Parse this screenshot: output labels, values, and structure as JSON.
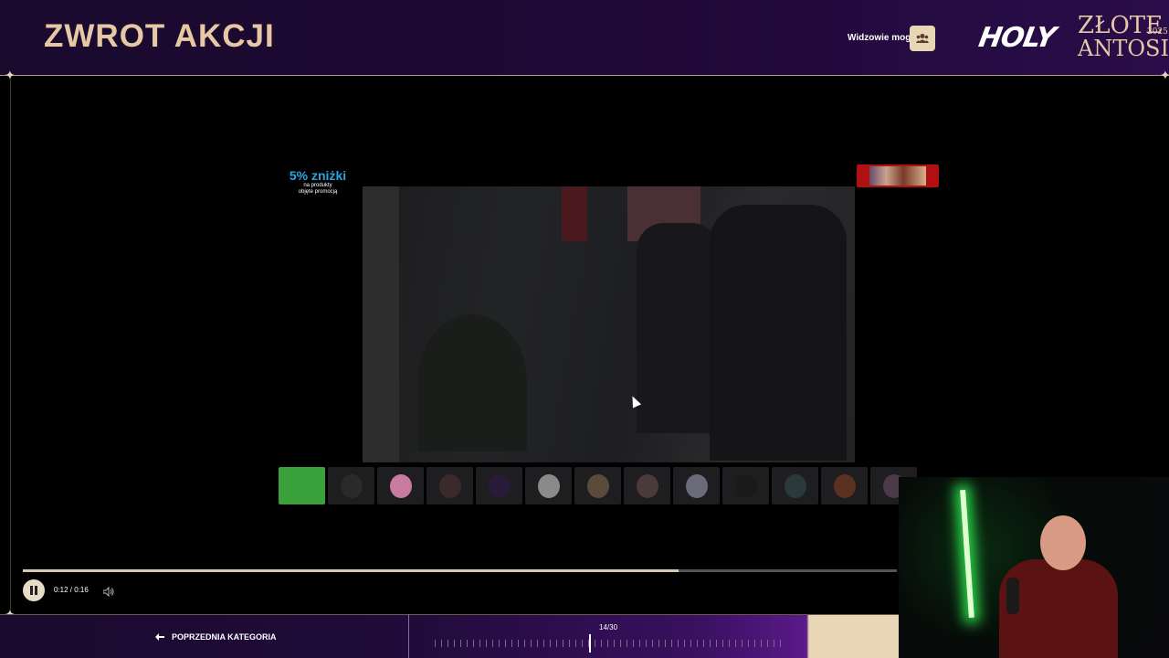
{
  "header": {
    "title": "ZWROT AKCJI",
    "viewers_label": "Widzowie mogą",
    "viewers_icon": "users-icon",
    "logo_holy": "HOLY",
    "logo_zlote_line1": "ZŁOTE",
    "logo_zlote_line2": "ANTOSIE",
    "logo_year": "2025"
  },
  "promo": {
    "title": "5% zniżki",
    "subtitle_line1": "na produkty",
    "subtitle_line2": "objęte promocją"
  },
  "player": {
    "time": "0:12 / 0:16",
    "progress": 0.75,
    "state": "playing"
  },
  "navigation": {
    "previous_label": "POPRZEDNIA KATEGORIA",
    "counter": "14/30",
    "current": 14,
    "total": 30
  },
  "thumbnails": [
    {
      "name": "nominee-1",
      "color": "#3aa03a"
    },
    {
      "name": "nominee-2",
      "color": "#2a2a2a"
    },
    {
      "name": "nominee-3",
      "color": "#c87aa0"
    },
    {
      "name": "nominee-4",
      "color": "#3a2a2a"
    },
    {
      "name": "nominee-5",
      "color": "#2a1a3a"
    },
    {
      "name": "nominee-6",
      "color": "#8a8a8a"
    },
    {
      "name": "nominee-7",
      "color": "#5a4a3a"
    },
    {
      "name": "nominee-8",
      "color": "#4a3a3a"
    },
    {
      "name": "nominee-9",
      "color": "#6a6a7a"
    },
    {
      "name": "nominee-10",
      "color": "#1a1a1a"
    },
    {
      "name": "nominee-11",
      "color": "#2a3a3a"
    },
    {
      "name": "nominee-12",
      "color": "#5a3020"
    },
    {
      "name": "nominee-13",
      "color": "#4a3a4a"
    }
  ],
  "colors": {
    "accent_gold": "#e6c9a4",
    "header_purple": "#1d0833",
    "promo_blue": "#2aa6e0"
  }
}
